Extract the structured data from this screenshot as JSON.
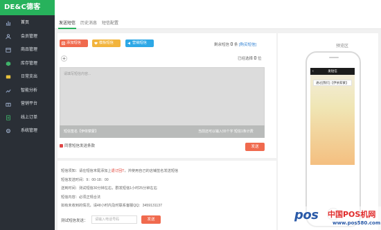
{
  "brand": {
    "name": "DE&C德客"
  },
  "sidebar": {
    "items": [
      {
        "label": "首页",
        "icon": "bar-chart-icon"
      },
      {
        "label": "会员管理",
        "icon": "user-icon"
      },
      {
        "label": "商品管理",
        "icon": "box-icon"
      },
      {
        "label": "库存管理",
        "icon": "cube-icon"
      },
      {
        "label": "日常支出",
        "icon": "wallet-icon"
      },
      {
        "label": "智能分析",
        "icon": "analytics-icon"
      },
      {
        "label": "营销平台",
        "icon": "gift-icon"
      },
      {
        "label": "线上订单",
        "icon": "order-icon"
      },
      {
        "label": "系统管理",
        "icon": "gear-icon"
      }
    ]
  },
  "tabs": [
    {
      "label": "发送短信",
      "active": true
    },
    {
      "label": "历史消息",
      "active": false
    },
    {
      "label": "短信配置",
      "active": false
    }
  ],
  "actions": {
    "btn1": "添加短信",
    "btn2": "模板短信",
    "btn3": "营销短信"
  },
  "balance": {
    "prefix": "剩余短信",
    "count": "0",
    "unit": "条",
    "buy_link": "[购买短信]"
  },
  "selected": {
    "prefix": "已经选择",
    "count": "0",
    "unit": "位"
  },
  "message": {
    "placeholder": "请填写短信内容...",
    "signature": "短信签名【伊依萦蒙】",
    "counter": "当前还可以输入55个字    短信1条计费"
  },
  "agree_label": "同意短信发送条款",
  "send_label": "发送",
  "preview": {
    "title": "预览区",
    "header": "发短信",
    "bubble": "通过[我们]【伊依萦蒙】"
  },
  "notes": [
    {
      "text": "短信须知：请在短信末尾添加上",
      "highlight": "退订回T",
      "tail": "，并使用自己的店铺签名发送短信"
    },
    {
      "text": "短信发送时间：9：00-18：00",
      "highlight": "",
      "tail": ""
    },
    {
      "text": "送到时间：测试短信30分钟左右，群发短信1小时25分钟左右",
      "highlight": "",
      "tail": ""
    },
    {
      "text": "短信内容：必须正规合法",
      "highlight": "",
      "tail": ""
    },
    {
      "text": "如有未收到的情况，请48小时内及时联系客服QQ：3459131137",
      "highlight": "",
      "tail": ""
    }
  ],
  "test": {
    "label": "测试短信发送：",
    "placeholder": "请输入电话号码",
    "send_label": "发送"
  },
  "watermark": {
    "logo": "pos",
    "cn": "中国POS机网",
    "url": "www.pos580.com"
  },
  "colors": {
    "brand_green": "#27b25c",
    "sidebar_bg": "#2a2f36",
    "red": "#f06a4e",
    "orange": "#f2b43c",
    "blue": "#2da8e6",
    "link": "#2d7fd3"
  }
}
